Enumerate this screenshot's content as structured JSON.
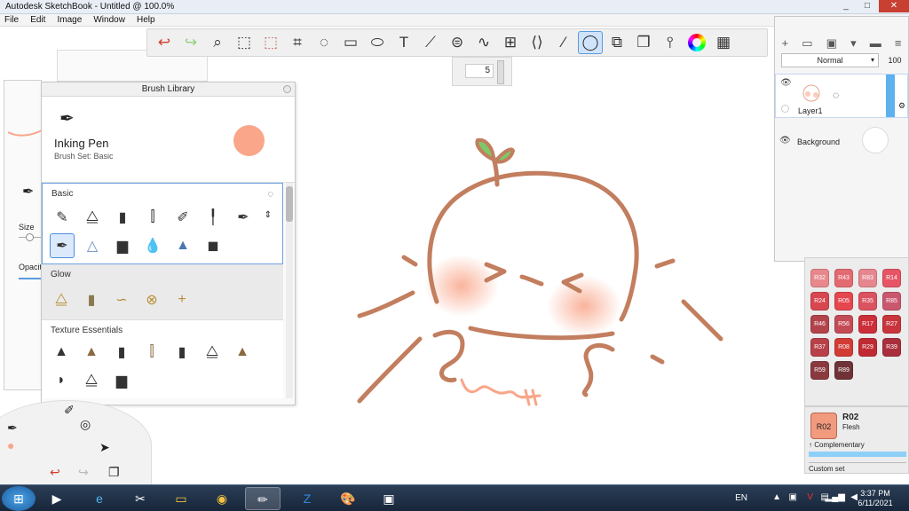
{
  "window": {
    "title": "Autodesk SketchBook - Untitled @ 100.0%",
    "min": "_",
    "max": "□",
    "close": "✕"
  },
  "menu": [
    "File",
    "Edit",
    "Image",
    "Window",
    "Help"
  ],
  "toolbar": {
    "icons": [
      "undo-icon",
      "redo-icon",
      "zoom-icon",
      "select-icon",
      "crop-select-icon",
      "crop-icon",
      "lasso-icon",
      "transform-icon",
      "fill-icon",
      "text-icon",
      "ruler-icon",
      "ellipse-guide-icon",
      "curve-icon",
      "perspective-icon",
      "symmetry-icon",
      "stroke-icon",
      "predictive-stroke-icon",
      "shape-icon",
      "copy-paste-icon",
      "brush-set-icon",
      "color-wheel-icon",
      "grid-icon"
    ],
    "brush_size": "5"
  },
  "left_panel": {
    "size_label": "Size",
    "opacity_label": "Opacit"
  },
  "brush_library": {
    "header": "Brush Library",
    "current_name": "Inking Pen",
    "current_set": "Brush Set: Basic",
    "sections": {
      "basic": "Basic",
      "glow": "Glow",
      "texture": "Texture Essentials"
    }
  },
  "layers": {
    "blend_mode": "Normal",
    "opacity": "100",
    "layer1": "Layer1",
    "background": "Background"
  },
  "palette": {
    "swatches": [
      {
        "code": "R32",
        "color": "#e8888c"
      },
      {
        "code": "R43",
        "color": "#e46a72"
      },
      {
        "code": "R83",
        "color": "#e6868f"
      },
      {
        "code": "R14",
        "color": "#e65566"
      },
      {
        "code": "R24",
        "color": "#d8474f"
      },
      {
        "code": "R05",
        "color": "#e6464e"
      },
      {
        "code": "R35",
        "color": "#db5360"
      },
      {
        "code": "R85",
        "color": "#c9586f"
      },
      {
        "code": "R46",
        "color": "#b3434b"
      },
      {
        "code": "R56",
        "color": "#c44b56"
      },
      {
        "code": "R17",
        "color": "#cc2f3a"
      },
      {
        "code": "R27",
        "color": "#c9353d"
      },
      {
        "code": "R37",
        "color": "#b84049"
      },
      {
        "code": "R08",
        "color": "#d23c35"
      },
      {
        "code": "R29",
        "color": "#c02b33"
      },
      {
        "code": "R39",
        "color": "#a92f3c"
      },
      {
        "code": "R59",
        "color": "#8a3a3f"
      },
      {
        "code": "R89",
        "color": "#6f3337"
      }
    ],
    "selected_code": "R02",
    "selected_name": "Flesh",
    "complementary": "Complementary",
    "custom_set": "Custom set"
  },
  "taskbar": {
    "lang": "EN",
    "time": "3:37 PM",
    "date": "6/11/2021"
  }
}
